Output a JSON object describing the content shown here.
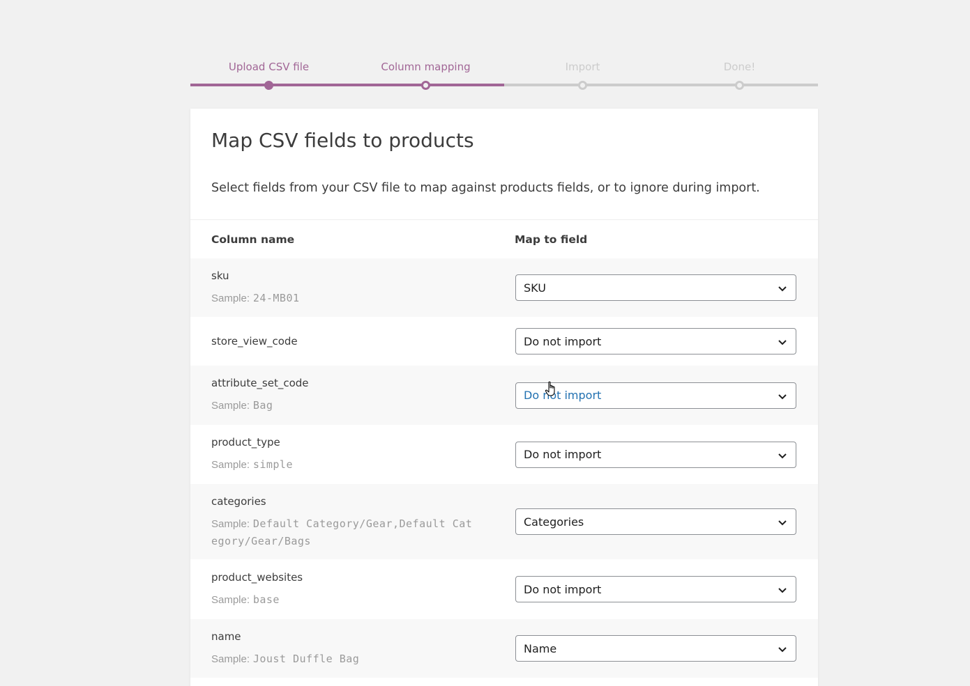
{
  "steps": [
    {
      "label": "Upload CSV file",
      "state": "complete"
    },
    {
      "label": "Column mapping",
      "state": "active"
    },
    {
      "label": "Import",
      "state": "pending"
    },
    {
      "label": "Done!",
      "state": "pending"
    }
  ],
  "header": {
    "title": "Map CSV fields to products",
    "description": "Select fields from your CSV file to map against products fields, or to ignore during import."
  },
  "table": {
    "col_name_header": "Column name",
    "map_field_header": "Map to field",
    "sample_prefix": "Sample:",
    "rows": [
      {
        "column": "sku",
        "sample": "24-MB01",
        "mapped": "SKU"
      },
      {
        "column": "store_view_code",
        "sample": "",
        "mapped": "Do not import"
      },
      {
        "column": "attribute_set_code",
        "sample": "Bag",
        "mapped": "Do not import"
      },
      {
        "column": "product_type",
        "sample": "simple",
        "mapped": "Do not import"
      },
      {
        "column": "categories",
        "sample": "Default Category/Gear,Default Category/Gear/Bags",
        "mapped": "Categories"
      },
      {
        "column": "product_websites",
        "sample": "base",
        "mapped": "Do not import"
      },
      {
        "column": "name",
        "sample": "Joust Duffle Bag",
        "mapped": "Name"
      }
    ]
  },
  "colors": {
    "accent": "#a16696",
    "inactive": "#cccccc",
    "link_hover": "#2271b1"
  },
  "icons": {
    "select_arrow": "chevron-down-icon",
    "cursor": "hand-pointer-cursor"
  }
}
